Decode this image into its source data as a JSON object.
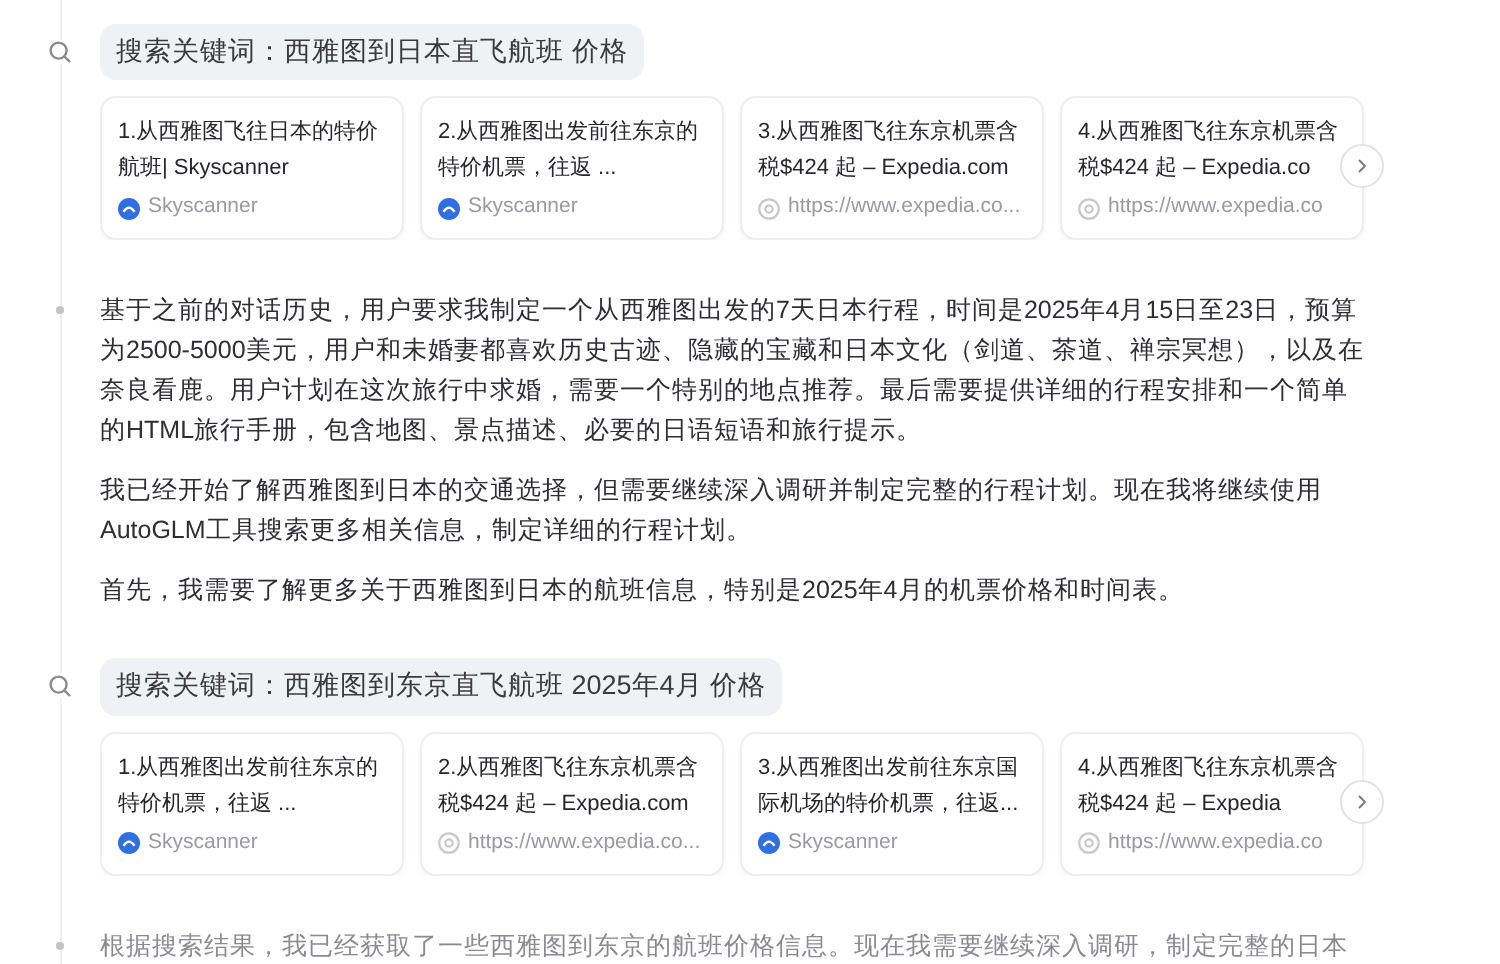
{
  "blocks": [
    {
      "kind": "search",
      "query": "搜索关键词：西雅图到日本直飞航班 价格",
      "results": [
        {
          "lines": [
            "1.从西雅图飞往日本的特价",
            "航班| Skyscanner"
          ],
          "kind": "skyscanner",
          "source": "Skyscanner"
        },
        {
          "lines": [
            "2.从西雅图出发前往东京的",
            "特价机票，往返 ..."
          ],
          "kind": "skyscanner",
          "source": "Skyscanner"
        },
        {
          "lines": [
            "3.从西雅图飞往东京机票含",
            "税$424 起 – Expedia.com"
          ],
          "kind": "web",
          "source": "https://www.expedia.co..."
        },
        {
          "lines": [
            "4.从西雅图飞往东京机票含",
            "税$424 起 – Expedia.co"
          ],
          "kind": "web",
          "source": "https://www.expedia.co"
        }
      ]
    },
    {
      "kind": "thought",
      "faded": false,
      "paragraphs": [
        "基于之前的对话历史，用户要求我制定一个从西雅图出发的7天日本行程，时间是2025年4月15日至23日，预算为2500-5000美元，用户和未婚妻都喜欢历史古迹、隐藏的宝藏和日本文化（剑道、茶道、禅宗冥想），以及在奈良看鹿。用户计划在这次旅行中求婚，需要一个特别的地点推荐。最后需要提供详细的行程安排和一个简单的HTML旅行手册，包含地图、景点描述、必要的日语短语和旅行提示。",
        "我已经开始了解西雅图到日本的交通选择，但需要继续深入调研并制定完整的行程计划。现在我将继续使用AutoGLM工具搜索更多相关信息，制定详细的行程计划。",
        "首先，我需要了解更多关于西雅图到日本的航班信息，特别是2025年4月的机票价格和时间表。"
      ]
    },
    {
      "kind": "search",
      "query": "搜索关键词：西雅图到东京直飞航班 2025年4月 价格",
      "results": [
        {
          "lines": [
            "1.从西雅图出发前往东京的",
            "特价机票，往返 ..."
          ],
          "kind": "skyscanner",
          "source": "Skyscanner"
        },
        {
          "lines": [
            "2.从西雅图飞往东京机票含",
            "税$424 起 – Expedia.com"
          ],
          "kind": "web",
          "source": "https://www.expedia.co..."
        },
        {
          "lines": [
            "3.从西雅图出发前往东京国",
            "际机场的特价机票，往返..."
          ],
          "kind": "skyscanner",
          "source": "Skyscanner"
        },
        {
          "lines": [
            "4.从西雅图飞往东京机票含",
            "税$424 起 – Expedia"
          ],
          "kind": "web",
          "source": "https://www.expedia.co"
        }
      ]
    },
    {
      "kind": "thought",
      "faded": true,
      "paragraphs": [
        "根据搜索结果，我已经获取了一些西雅图到东京的航班价格信息。现在我需要继续深入调研，制定完整的日本"
      ]
    }
  ]
}
